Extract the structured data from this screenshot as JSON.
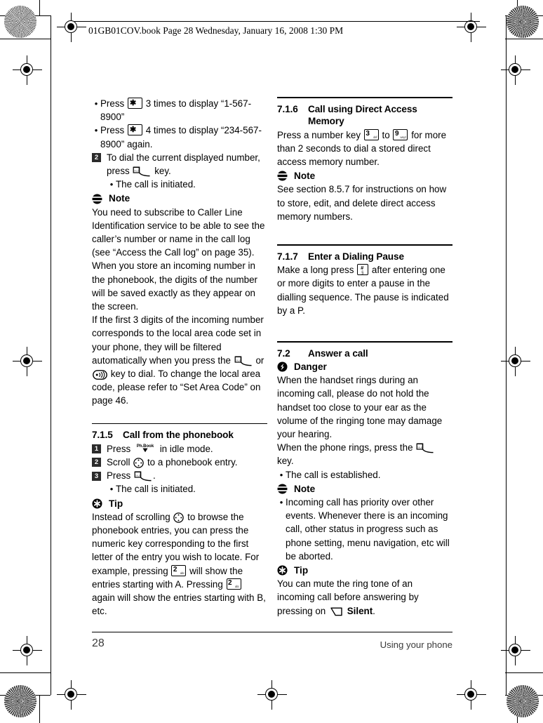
{
  "header": {
    "text": "01GB01COV.book  Page 28  Wednesday, January 16, 2008  1:30 PM"
  },
  "footer": {
    "page_number": "28",
    "section_title": "Using your phone"
  },
  "left_column": {
    "bullets_top": [
      {
        "pre": "Press",
        "key": "star-key",
        "post": "3 times to display “1-567-8900”"
      },
      {
        "pre": "Press",
        "key": "star-key",
        "post": "4 times to display “234-567-8900” again."
      }
    ],
    "step2": {
      "badge": "2",
      "pre": "To dial the current displayed number, press",
      "key": "talk-key",
      "post": "key."
    },
    "step2_bullet": "The call is initiated.",
    "note1": {
      "label": "Note",
      "icon": "note-icon",
      "paragraphs": [
        "You need to subscribe to Caller Line Identification service to be able to see the caller’s number or name in the call log (see “Access the Call log” on page 35).",
        "When you store an incoming number in the phonebook, the digits of the number will be saved exactly as they appear on the screen."
      ],
      "para_with_icons": {
        "part1": "If the first 3 digits of the incoming number corresponds to the local area code set in your phone, they will be filtered automatically when you press the",
        "icon1": "talk-key",
        "mid": "or",
        "icon2": "speakerphone-key",
        "part2": "key to dial. To change the local area code, please refer to “Set Area Code” on page 46."
      }
    },
    "section_715": {
      "number": "7.1.5",
      "title": "Call from the phonebook",
      "steps": [
        {
          "badge": "1",
          "pre": "Press",
          "key": "phonebook-key",
          "post": "in idle mode."
        },
        {
          "badge": "2",
          "pre": "Scroll",
          "key": "nav-key",
          "post": "to a phonebook entry."
        },
        {
          "badge": "3",
          "pre": "Press",
          "key": "talk-key",
          "post": "."
        }
      ],
      "step_bullet": "The call is initiated.",
      "tip": {
        "label": "Tip",
        "icon": "tip-icon",
        "part1": "Instead of scrolling",
        "icon1": "nav-key",
        "part2": "to browse the phonebook entries, you can press the numeric key corresponding to the first letter of the entry you wish to locate. For example, pressing",
        "icon2": "two-key",
        "part3": "will show the entries starting with A. Pressing",
        "icon3": "two-key",
        "part4": "again will show the entries starting with B, etc."
      }
    }
  },
  "right_column": {
    "section_716": {
      "number": "7.1.6",
      "title": "Call using Direct Access",
      "title_cont": "Memory",
      "body_part1": "Press a number key",
      "key1": "three-key",
      "body_mid": "to",
      "key2": "nine-key",
      "body_part2": "for more than 2 seconds to dial a stored direct access memory number.",
      "note": {
        "label": "Note",
        "icon": "note-icon",
        "text": "See section 8.5.7 for instructions on how to store, edit, and delete direct access memory numbers."
      }
    },
    "section_717": {
      "number": "7.1.7",
      "title": "Enter a Dialing Pause",
      "part1": "Make a long press",
      "key": "hash-key",
      "part2": "after entering one or more digits to enter a pause in the dialling sequence. The pause is indicated by a P."
    },
    "section_72": {
      "number": "7.2",
      "title": "Answer a call",
      "danger": {
        "label": "Danger",
        "icon": "danger-icon",
        "text": "When the handset rings during an incoming call, please do not hold the handset too close to your ear as the volume of the ringing tone may damage your hearing."
      },
      "press_line": {
        "part1": "When the phone rings, press the",
        "key": "talk-key",
        "part2": "key."
      },
      "bullet_established": "The call is established.",
      "note": {
        "label": "Note",
        "icon": "note-icon",
        "bullet": "Incoming call has priority over other events. Whenever there is an incoming call, other status in progress such as phone setting, menu navigation, etc will be aborted."
      },
      "tip": {
        "label": "Tip",
        "icon": "tip-icon",
        "part1": "You can mute the ring tone of an incoming call before answering by pressing on",
        "icon1": "softkey",
        "part2": "Silent",
        "part3": "."
      }
    }
  },
  "keys": {
    "star": {
      "main": "✱",
      "sub": ""
    },
    "two": {
      "main": "2",
      "sub": "abc"
    },
    "three": {
      "main": "3",
      "sub": "def"
    },
    "nine": {
      "main": "9",
      "sub": "wxyz"
    },
    "hash": {
      "main": "#",
      "sub": "§"
    },
    "phonebook_label": "Ph.Book"
  },
  "colors": {
    "ink": "#000000",
    "badge_bg": "#2b2b2b",
    "footer_gray": "#3a3a3a"
  }
}
